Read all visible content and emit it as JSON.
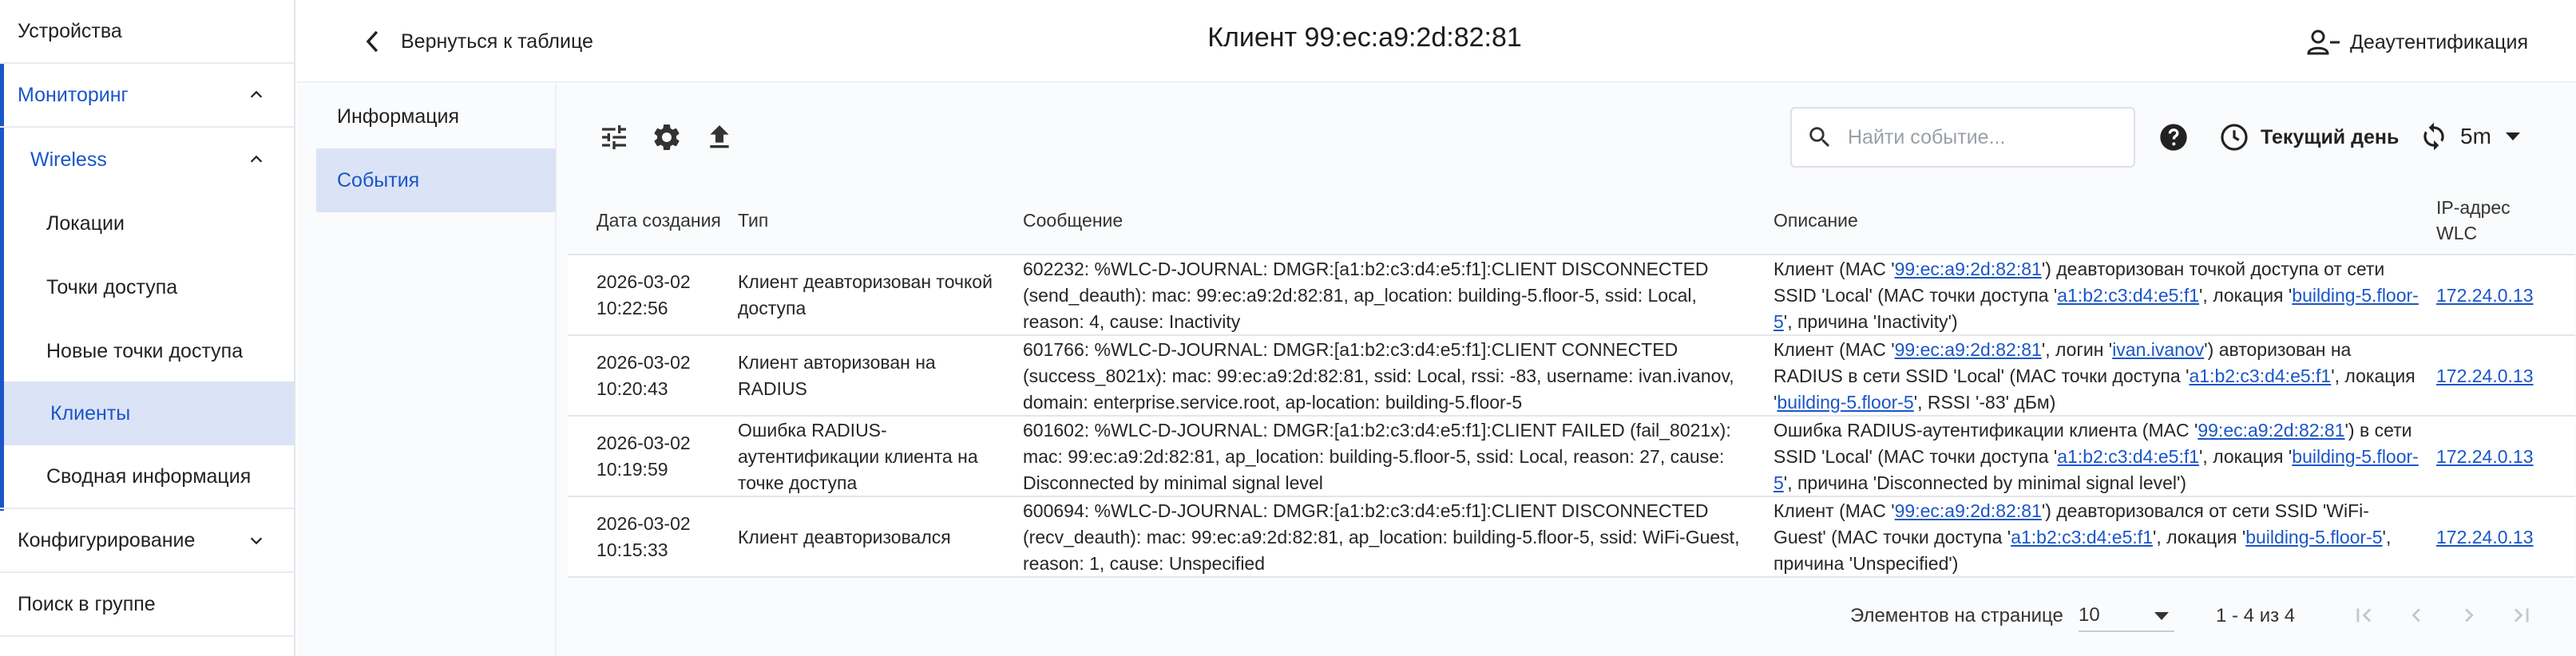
{
  "sidebar": {
    "items": [
      {
        "label": "Устройства"
      },
      {
        "label": "Мониторинг"
      },
      {
        "label": "Wireless"
      },
      {
        "label": "Локации"
      },
      {
        "label": "Точки доступа"
      },
      {
        "label": "Новые точки доступа"
      },
      {
        "label": "Клиенты"
      },
      {
        "label": "Сводная информация"
      },
      {
        "label": "Конфигурирование"
      },
      {
        "label": "Поиск в группе"
      }
    ]
  },
  "header": {
    "back_label": "Вернуться к таблице",
    "title": "Клиент 99:ec:a9:2d:82:81",
    "deauth_label": "Деаутентификация"
  },
  "inner_tabs": [
    {
      "label": "Информация"
    },
    {
      "label": "События"
    }
  ],
  "toolbar": {
    "search_placeholder": "Найти событие...",
    "period_label": "Текущий день",
    "refresh_interval": "5m"
  },
  "table": {
    "columns": [
      "Дата создания",
      "Тип",
      "Сообщение",
      "Описание",
      "IP-адрес WLC"
    ],
    "rows": [
      {
        "date": "2026-03-02",
        "time": "10:22:56",
        "type": "Клиент деавторизован точкой доступа",
        "message": "602232: %WLC-D-JOURNAL: DMGR:[a1:b2:c3:d4:e5:f1]:CLIENT DISCONNECTED (send_deauth): mac: 99:ec:a9:2d:82:81, ap_location: building-5.floor-5, ssid: Local, reason: 4, cause: Inactivity",
        "desc": [
          "Клиент (MAC '",
          {
            "link": "99:ec:a9:2d:82:81"
          },
          "') деавторизован точкой доступа от сети SSID 'Local' (MAC точки доступа '",
          {
            "link": "a1:b2:c3:d4:e5:f1"
          },
          "', локация '",
          {
            "link": "building-5.floor-5"
          },
          "', причина 'Inactivity')"
        ],
        "ip": "172.24.0.13"
      },
      {
        "date": "2026-03-02",
        "time": "10:20:43",
        "type": "Клиент авторизован на RADIUS",
        "message": "601766: %WLC-D-JOURNAL: DMGR:[a1:b2:c3:d4:e5:f1]:CLIENT CONNECTED (success_8021x): mac: 99:ec:a9:2d:82:81, ssid: Local, rssi: -83, username: ivan.ivanov, domain: enterprise.service.root, ap-location: building-5.floor-5",
        "desc": [
          "Клиент (MAC '",
          {
            "link": "99:ec:a9:2d:82:81"
          },
          "', логин '",
          {
            "link": "ivan.ivanov"
          },
          "') авторизован на RADIUS в сети SSID 'Local' (MAC точки доступа '",
          {
            "link": "a1:b2:c3:d4:e5:f1"
          },
          "', локация '",
          {
            "link": "building-5.floor-5"
          },
          "', RSSI '-83' дБм)"
        ],
        "ip": "172.24.0.13"
      },
      {
        "date": "2026-03-02",
        "time": "10:19:59",
        "type": "Ошибка RADIUS-аутентификации клиента на точке доступа",
        "message": "601602: %WLC-D-JOURNAL: DMGR:[a1:b2:c3:d4:e5:f1]:CLIENT FAILED (fail_8021x): mac: 99:ec:a9:2d:82:81, ap_location: building-5.floor-5, ssid: Local, reason: 27, cause: Disconnected by minimal signal level",
        "desc": [
          "Ошибка RADIUS-аутентификации клиента (MAC '",
          {
            "link": "99:ec:a9:2d:82:81"
          },
          "') в сети SSID 'Local' (MAC точки доступа '",
          {
            "link": "a1:b2:c3:d4:e5:f1"
          },
          "', локация '",
          {
            "link": "building-5.floor-5"
          },
          "', причина 'Disconnected by minimal signal level')"
        ],
        "ip": "172.24.0.13"
      },
      {
        "date": "2026-03-02",
        "time": "10:15:33",
        "type": "Клиент деавторизовался",
        "message": "600694: %WLC-D-JOURNAL: DMGR:[a1:b2:c3:d4:e5:f1]:CLIENT DISCONNECTED (recv_deauth): mac: 99:ec:a9:2d:82:81, ap_location: building-5.floor-5, ssid: WiFi-Guest, reason: 1, cause: Unspecified",
        "desc": [
          "Клиент (MAC '",
          {
            "link": "99:ec:a9:2d:82:81"
          },
          "') деавторизовался от сети SSID 'WiFi-Guest' (MAC точки доступа '",
          {
            "link": "a1:b2:c3:d4:e5:f1"
          },
          "', локация '",
          {
            "link": "building-5.floor-5"
          },
          "', причина 'Unspecified')"
        ],
        "ip": "172.24.0.13"
      }
    ]
  },
  "pagination": {
    "per_page_label": "Элементов на странице",
    "per_page_value": "10",
    "range": "1 - 4 из 4"
  },
  "colors": {
    "accent": "#1a56c9",
    "active_bg": "#dbe3f6"
  }
}
